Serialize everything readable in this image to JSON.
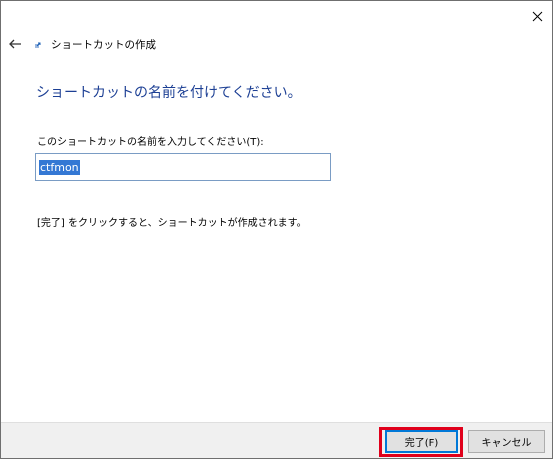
{
  "window": {
    "close_glyph": "✕"
  },
  "wizard": {
    "title": "ショートカットの作成",
    "back_icon": "arrow-left-icon",
    "app_icon": "shortcut-icon"
  },
  "main": {
    "heading": "ショートカットの名前を付けてください。",
    "field_label": "このショートカットの名前を入力してください(T):",
    "field_value": "ctfmon",
    "info_text": "[完了] をクリックすると、ショートカットが作成されます。"
  },
  "buttons": {
    "finish_label": "完了(F)",
    "cancel_label": "キャンセル"
  },
  "colors": {
    "heading": "#1c3f94",
    "selection": "#3478d4",
    "highlight": "#e0001b",
    "footer_bg": "#f0f0f0"
  }
}
